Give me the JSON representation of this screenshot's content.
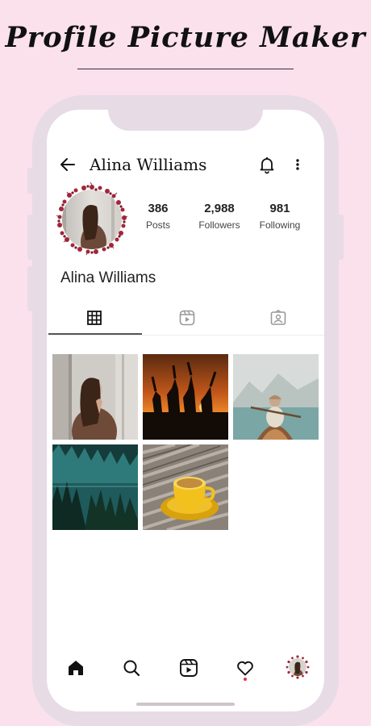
{
  "headline": "Profile Picture Maker",
  "profile": {
    "name": "Alina Williams",
    "display_name": "Alina Williams",
    "stats": [
      {
        "value": "386",
        "label": "Posts"
      },
      {
        "value": "2,988",
        "label": "Followers"
      },
      {
        "value": "981",
        "label": "Following"
      }
    ]
  },
  "tabs": [
    "grid-icon",
    "reels-icon",
    "tagged-icon"
  ],
  "nav": [
    "home-icon",
    "search-icon",
    "reels-icon",
    "heart-icon",
    "profile-avatar"
  ],
  "colors": {
    "background": "#fbe1ec",
    "frame": "#e7dbe6",
    "wreath": "#a3263a",
    "notification_dot": "#e0304d"
  }
}
